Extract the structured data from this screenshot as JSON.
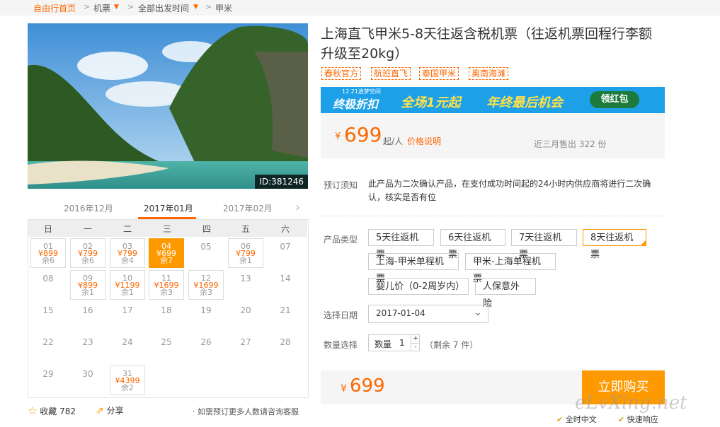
{
  "breadcrumb": {
    "home": "自由行首页",
    "flights": "机票",
    "departure": "全部出发时间",
    "destination": "甲米"
  },
  "hero": {
    "id_label": "ID:381246"
  },
  "calendar": {
    "months": [
      "2016年12月",
      "2017年01月",
      "2017年02月"
    ],
    "weekdays": [
      "日",
      "一",
      "二",
      "三",
      "四",
      "五",
      "六"
    ],
    "days": [
      {
        "d": "01",
        "p": "¥899",
        "r": "余6"
      },
      {
        "d": "02",
        "p": "¥799",
        "r": "余6"
      },
      {
        "d": "03",
        "p": "¥799",
        "r": "余4"
      },
      {
        "d": "04",
        "p": "¥699",
        "r": "余7"
      },
      {
        "d": "05"
      },
      {
        "d": "06",
        "p": "¥799",
        "r": "余1"
      },
      {
        "d": "07"
      },
      {
        "d": "08"
      },
      {
        "d": "09",
        "p": "¥899",
        "r": "余1"
      },
      {
        "d": "10",
        "p": "¥1199",
        "r": "余1"
      },
      {
        "d": "11",
        "p": "¥1699",
        "r": "余3"
      },
      {
        "d": "12",
        "p": "¥1699",
        "r": "余3"
      },
      {
        "d": "13"
      },
      {
        "d": "14"
      },
      {
        "d": "15"
      },
      {
        "d": "16"
      },
      {
        "d": "17"
      },
      {
        "d": "18"
      },
      {
        "d": "19"
      },
      {
        "d": "20"
      },
      {
        "d": "21"
      },
      {
        "d": "22"
      },
      {
        "d": "23"
      },
      {
        "d": "24"
      },
      {
        "d": "25"
      },
      {
        "d": "26"
      },
      {
        "d": "27"
      },
      {
        "d": "28"
      },
      {
        "d": "29"
      },
      {
        "d": "30"
      },
      {
        "d": "31",
        "p": "¥4399",
        "r": "余2"
      }
    ]
  },
  "footer": {
    "favorite": "收藏",
    "favorite_count": "782",
    "share": "分享",
    "note": "· 如需预订更多人数请咨询客服"
  },
  "product": {
    "title": "上海直飞甲米5-8天往返含税机票（往返机票回程行李额升级至20kg）",
    "tags": [
      "春秋官方",
      "航班直飞",
      "泰国甲米",
      "奥南海滩"
    ],
    "banner": {
      "small": "12.21逍梦空间",
      "big": "终极折扣",
      "promo": "全场1元起",
      "promo2": "年终最后机会",
      "button": "领红包"
    },
    "price_symbol": "¥",
    "price": "699",
    "price_unit": "起/人",
    "price_note": "价格说明",
    "sold": "近三月售出 322 份",
    "booking_label": "预订须知",
    "booking_text": "此产品为二次确认产品，在支付成功时间起的24小时内供应商将进行二次确认，核实是否有位",
    "type_label": "产品类型",
    "types": [
      "5天往返机票",
      "6天往返机票",
      "7天往返机票",
      "8天往返机票",
      "上海-甲米单程机票",
      "甲米-上海单程机票",
      "婴儿价（0-2周岁内）",
      "人保意外险"
    ],
    "date_label": "选择日期",
    "date_value": "2017-01-04",
    "qty_label": "数量选择",
    "qty_prefix": "数量",
    "qty_value": "1",
    "qty_remaining": "（剩余 7 件）",
    "total_price": "699",
    "buy_button": "立即购买",
    "badges": [
      "全时中文",
      "快速响应"
    ],
    "watermark": "eLvXing.net"
  },
  "colors": {
    "accent": "#ff6600",
    "buy": "#ff9900",
    "banner": "#1da0e8"
  }
}
